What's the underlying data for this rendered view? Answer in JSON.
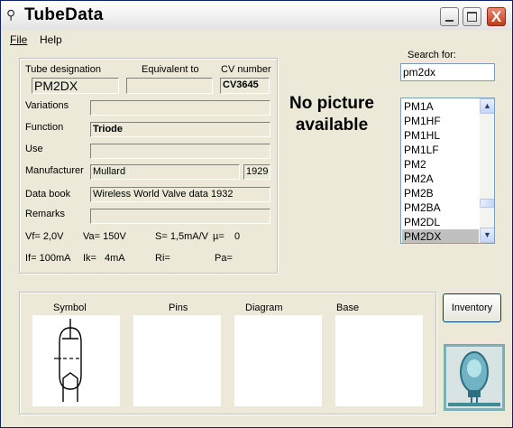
{
  "app": {
    "title": "TubeData"
  },
  "window_buttons": {
    "minimize": "_",
    "maximize": "□",
    "close": "X"
  },
  "menu": [
    {
      "label": "File"
    },
    {
      "label": "Help"
    }
  ],
  "fields": {
    "tube_designation_label": "Tube designation",
    "equivalent_label": "Equivalent to",
    "cv_label": "CV number",
    "tube_designation": "PM2DX",
    "equivalent": "",
    "cv_number": "CV3645",
    "variations_label": "Variations",
    "variations": "",
    "function_label": "Function",
    "function": "Triode",
    "use_label": "Use",
    "use": "",
    "manufacturer_label": "Manufacturer",
    "manufacturer": "Mullard",
    "year": "1929",
    "databook_label": "Data book",
    "databook": "Wireless World Valve data 1932",
    "remarks_label": "Remarks",
    "remarks": ""
  },
  "specs": {
    "vf": "Vf= 2,0V",
    "va": "Va= 150V",
    "s": "S= 1,5mA/V",
    "mu": "µ=",
    "mu_val": "0",
    "if": "If= 100mA",
    "ik": "Ik=",
    "ik_val": "4mA",
    "ri": "Ri=",
    "pa": "Pa="
  },
  "picture": {
    "placeholder": "No picture available"
  },
  "search": {
    "label": "Search for:",
    "value": "pm2dx"
  },
  "list": {
    "items": [
      "PM1A",
      "PM1HF",
      "PM1HL",
      "PM1LF",
      "PM2",
      "PM2A",
      "PM2B",
      "PM2BA",
      "PM2DL",
      "PM2DX"
    ],
    "selected": "PM2DX"
  },
  "panels": {
    "symbol": "Symbol",
    "pins": "Pins",
    "diagram": "Diagram",
    "base": "Base"
  },
  "buttons": {
    "inventory": "Inventory"
  }
}
